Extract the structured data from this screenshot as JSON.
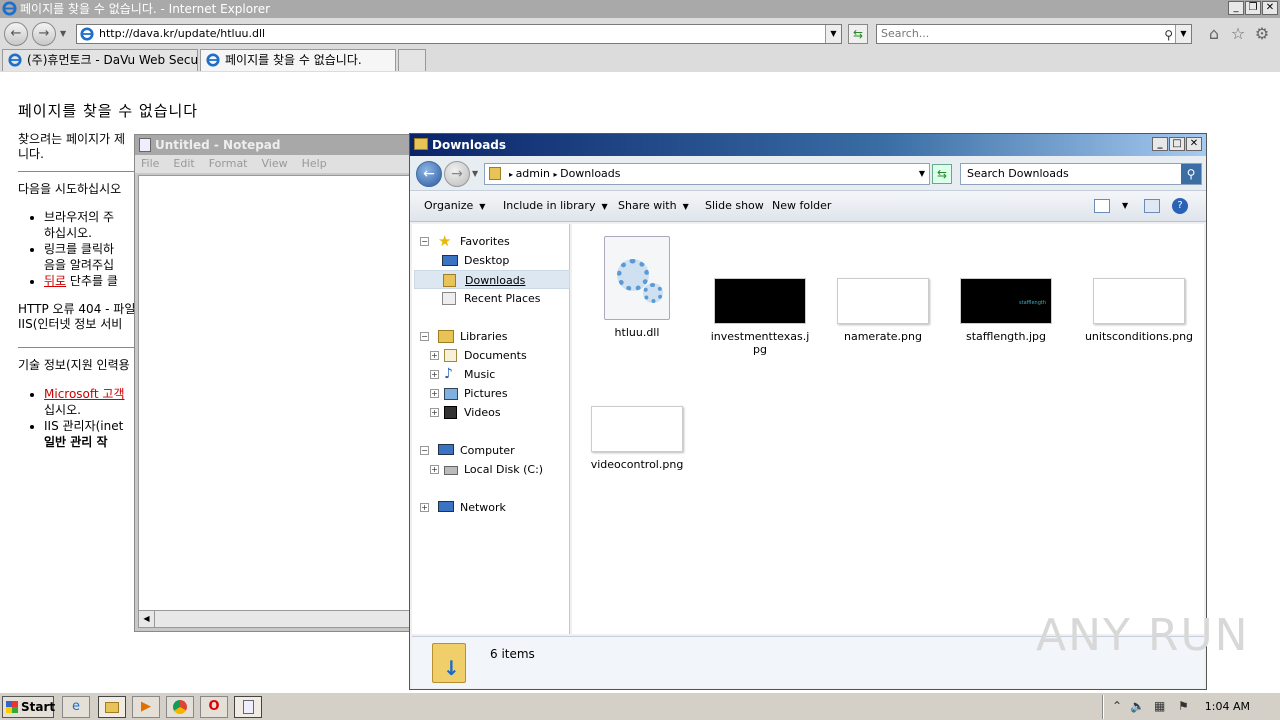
{
  "ie": {
    "title": "페이지를 찾을 수 없습니다. - Internet Explorer",
    "address": "http://dava.kr/update/htluu.dll",
    "search_placeholder": "Search...",
    "tabs": [
      {
        "label": "(주)휴먼토크 - DaVu Web Secu..."
      },
      {
        "label": "페이지를 찾을 수 없습니다."
      }
    ]
  },
  "page": {
    "heading": "페이지를 찾을 수 없습니다",
    "para1": "찾으려는 페이지가 제",
    "para1b": "니다.",
    "try_label": "다음을 시도하십시오",
    "bullets": [
      {
        "line1": "브라우저의 주",
        "line2": "하십시오."
      },
      {
        "line1": "링크를 클릭하",
        "line2": "음을 알려주십"
      },
      {
        "link": "뒤로",
        "rest": " 단추를 클"
      }
    ],
    "http_error1": "HTTP 오류 404 - 파일",
    "http_error2": "IIS(인터넷 정보 서비",
    "tech_label": "기술 정보(지원 인력용",
    "tech_bullets": [
      {
        "link": "Microsoft 고객",
        "line2": "십시오."
      },
      {
        "line1": "IIS 관리자(inet",
        "bold": "일반 관리 작"
      }
    ]
  },
  "notepad": {
    "title": "Untitled - Notepad",
    "menu": [
      "File",
      "Edit",
      "Format",
      "View",
      "Help"
    ]
  },
  "explorer": {
    "title": "Downloads",
    "breadcrumb": [
      "admin",
      "Downloads"
    ],
    "search_placeholder": "Search Downloads",
    "commands": {
      "organize": "Organize",
      "include": "Include in library",
      "share": "Share with",
      "slideshow": "Slide show",
      "newfolder": "New folder"
    },
    "nav": {
      "favorites": "Favorites",
      "desktop": "Desktop",
      "downloads": "Downloads",
      "recent": "Recent Places",
      "libraries": "Libraries",
      "documents": "Documents",
      "music": "Music",
      "pictures": "Pictures",
      "videos": "Videos",
      "computer": "Computer",
      "localdisk": "Local Disk (C:)",
      "network": "Network"
    },
    "files": [
      {
        "name": "htluu.dll",
        "kind": "dll"
      },
      {
        "name": "investmenttexas.jpg",
        "kind": "black"
      },
      {
        "name": "namerate.png",
        "kind": "white"
      },
      {
        "name": "stafflength.jpg",
        "kind": "black",
        "thumb_text": "stafflength"
      },
      {
        "name": "unitsconditions.png",
        "kind": "white"
      },
      {
        "name": "videocontrol.png",
        "kind": "white"
      }
    ],
    "item_count": "6 items"
  },
  "watermark": "ANY RUN",
  "taskbar": {
    "start": "Start",
    "clock": "1:04 AM"
  }
}
